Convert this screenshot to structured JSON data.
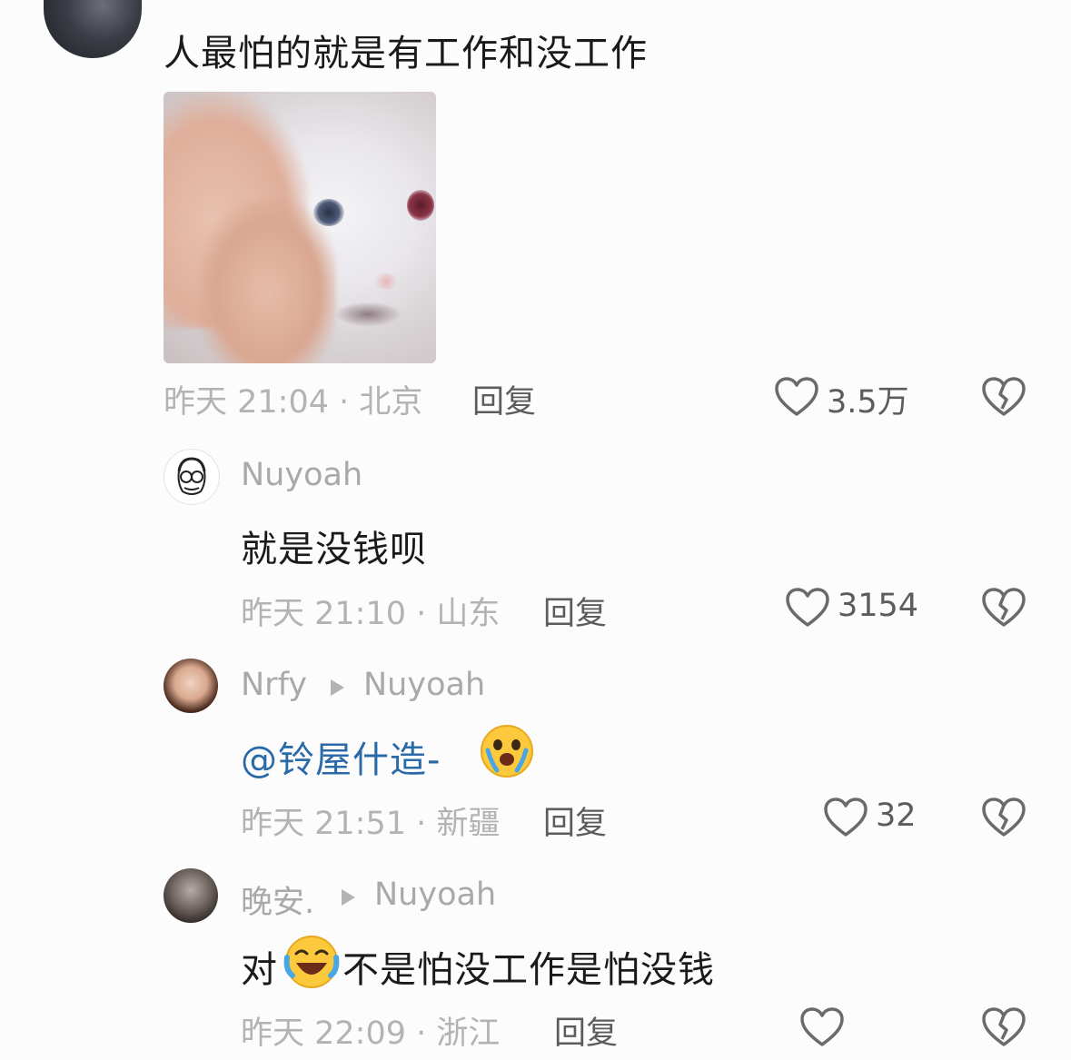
{
  "main_comment": {
    "text": "人最怕的就是有工作和没工作",
    "time_location": "昨天 21:04 · 北京",
    "reply_label": "回复",
    "likes": "3.5万",
    "avatar_icon": "user-avatar-icon",
    "image_icon": "cat-meme-image"
  },
  "replies": [
    {
      "user": "Nuyoah",
      "reply_to": "",
      "text": "就是没钱呗",
      "time_location": "昨天 21:10 · 山东",
      "reply_label": "回复",
      "likes": "3154"
    },
    {
      "user": "Nrfy",
      "reply_to": "Nuyoah",
      "mention": "@铃屋什造-",
      "text": "",
      "time_location": "昨天 21:51 · 新疆",
      "reply_label": "回复",
      "likes": "32"
    },
    {
      "user": "晚安.",
      "reply_to": "Nuyoah",
      "text_before": "对",
      "text_after": "不是怕没工作是怕没钱",
      "time_location": "昨天 22:09 · 浙江",
      "reply_label": "回复",
      "likes": ""
    }
  ],
  "icons": {
    "like": "heart-outline-icon",
    "dislike": "broken-heart-icon",
    "crying_emoji": "crying-emoji",
    "laughing_emoji": "laughing-crying-emoji"
  },
  "colors": {
    "background": "#fcfcfc",
    "text": "#1a1a1a",
    "meta": "#b3b3b3",
    "mention": "#2b6aa8"
  }
}
